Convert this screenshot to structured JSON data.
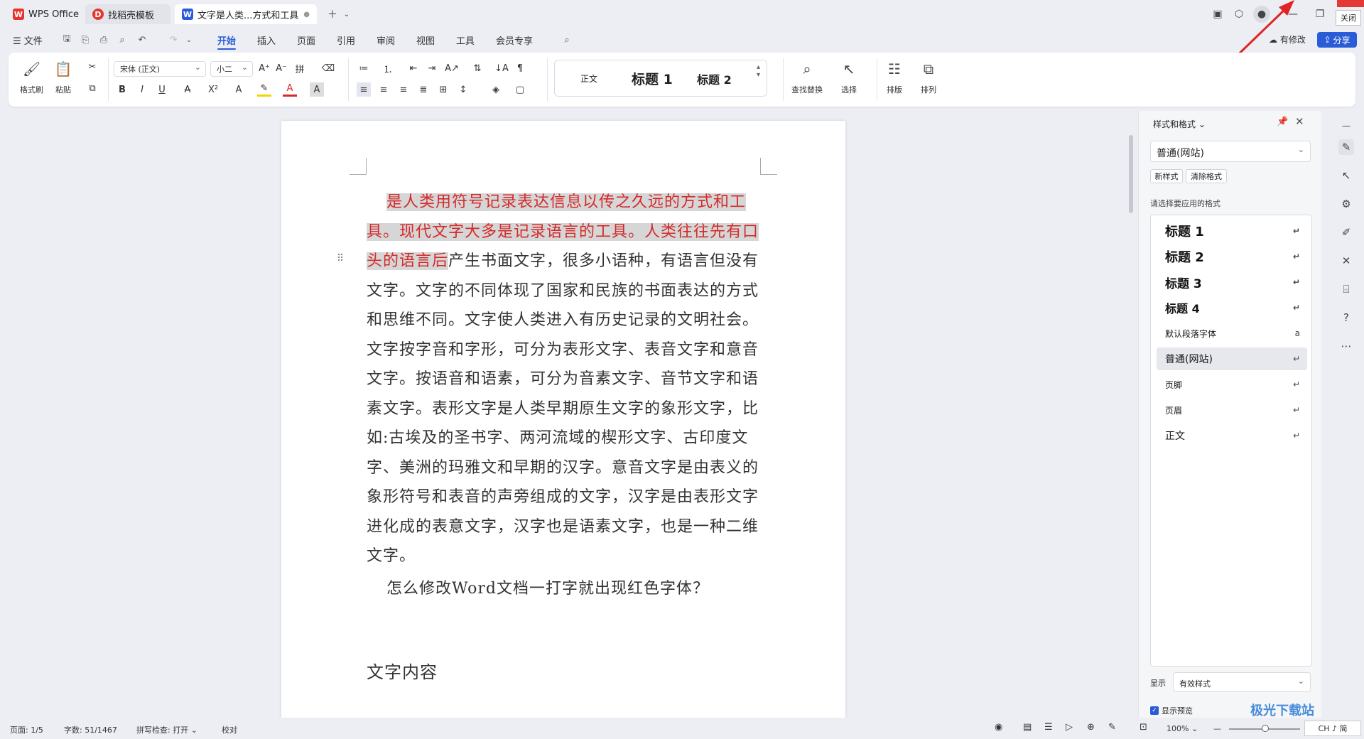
{
  "tabs": [
    {
      "label": "WPS Office",
      "icon": "wps-logo"
    },
    {
      "label": "找稻壳模板",
      "icon": "docer-icon"
    },
    {
      "label": "文字是人类...方式和工具",
      "icon": "word-doc-icon"
    }
  ],
  "window": {
    "close_tooltip": "关闭"
  },
  "menubar": {
    "file": "文件",
    "items": [
      "开始",
      "插入",
      "页面",
      "引用",
      "审阅",
      "视图",
      "工具",
      "会员专享"
    ],
    "active": "开始",
    "modified": "有修改",
    "share": "分享"
  },
  "ribbon": {
    "format_painter": "格式刷",
    "paste": "粘贴",
    "font_name": "宋体 (正文)",
    "font_size": "小二",
    "styles": [
      "正文",
      "标题 1",
      "标题 2"
    ],
    "find_replace": "查找替换",
    "select": "选择",
    "layout": "排版",
    "arrange": "排列"
  },
  "document": {
    "para1_highlight": "是人类用符号记录表达信息以传之久远的方式和工具。现代文字大多是记录语言的工具。人类往往先有口头的语言后",
    "para1_rest": "产生书面文字，很多小语种，有语言但没有文字。文字的不同体现了国家和民族的书面表达的方式和思维不同。文字使人类进入有历史记录的文明社会。文字按字音和字形，可分为表形文字、表音文字和意音文字。按语音和语素，可分为音素文字、音节文字和语素文字。表形文字是人类早期原生文字的象形文字，比如:古埃及的圣书字、两河流域的楔形文字、古印度文字、美洲的玛雅文和早期的汉字。意音文字是由表义的象形符号和表音的声旁组成的文字，汉字是由表形文字进化成的表意文字，汉字也是语素文字，也是一种二维文字。",
    "para2": "怎么修改Word文档一打字就出现红色字体？",
    "heading": "文字内容",
    "highlight_color": "#d42a2a"
  },
  "panel": {
    "title": "样式和格式",
    "current": "普通(网站)",
    "new_style": "新样式",
    "clear_format": "清除格式",
    "prompt": "请选择要应用的格式",
    "styles": [
      {
        "label": "标题  1",
        "kind": "h"
      },
      {
        "label": "标题  2",
        "kind": "h"
      },
      {
        "label": "标题  3",
        "kind": "h"
      },
      {
        "label": "标题  4",
        "kind": "h"
      },
      {
        "label": "默认段落字体",
        "kind": "s"
      },
      {
        "label": "普通(网站)",
        "kind": "n"
      },
      {
        "label": "页脚",
        "kind": "s"
      },
      {
        "label": "页眉",
        "kind": "s"
      },
      {
        "label": "正文",
        "kind": "n"
      }
    ],
    "selected": "普通(网站)",
    "show_label": "显示",
    "show_value": "有效样式",
    "preview_label": "显示预览",
    "preview_checked": true
  },
  "status": {
    "page": "页面: 1/5",
    "words": "字数: 51/1467",
    "spell": "拼写检查: 打开",
    "proof": "校对",
    "zoom": "100%",
    "ime": "CH ♪ 简"
  },
  "watermark": "极光下载站"
}
